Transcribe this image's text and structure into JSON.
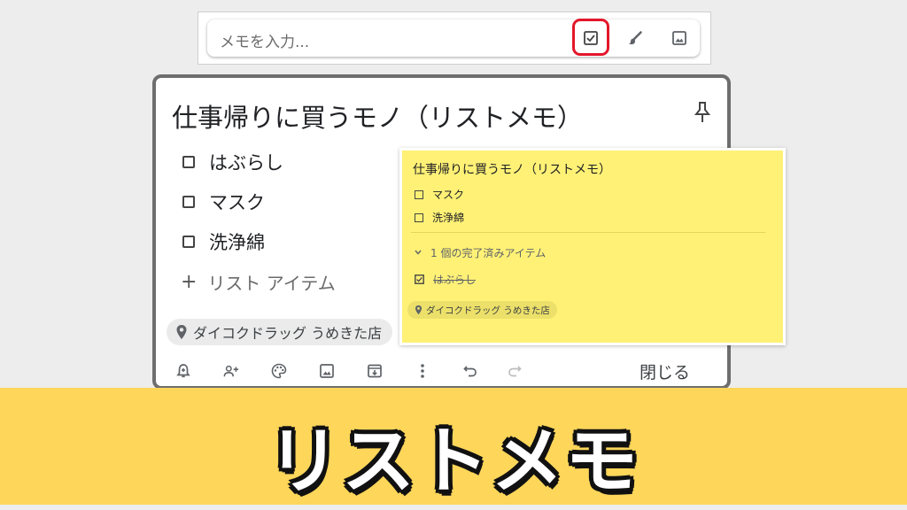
{
  "top_input": {
    "placeholder": "メモを入力...",
    "icons": [
      "checkbox-icon",
      "brush-icon",
      "image-icon"
    ],
    "highlight_color": "#e3172b"
  },
  "note": {
    "title": "仕事帰りに買うモノ（リストメモ）",
    "items": [
      "はぶらし",
      "マスク",
      "洗浄綿"
    ],
    "add_item_label": "リスト アイテム",
    "location": "ダイコクドラッグ うめきた店",
    "toolbar_icons": [
      "reminder-icon",
      "collaborator-icon",
      "palette-icon",
      "image-icon",
      "archive-icon",
      "more-icon",
      "undo-icon",
      "redo-icon"
    ],
    "close_label": "閉じる"
  },
  "preview": {
    "title": "仕事帰りに買うモノ（リストメモ）",
    "items": [
      "マスク",
      "洗浄綿"
    ],
    "completed_label": "1 個の完了済みアイテム",
    "completed_items": [
      "はぶらし"
    ],
    "location": "ダイコクドラッグ うめきた店",
    "bg_color": "#fff176"
  },
  "banner": {
    "title": "リストメモ",
    "bg_color": "#fdd65a"
  }
}
